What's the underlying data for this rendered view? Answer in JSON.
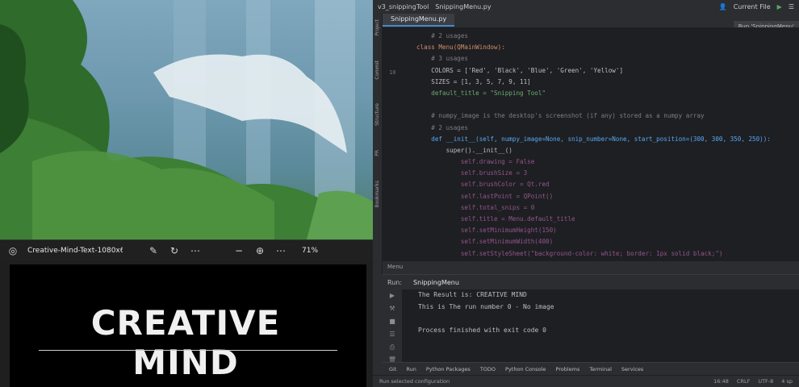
{
  "viewer": {
    "title": "Creative-Mind-Text-1080x6...",
    "zoom": "71%",
    "image_text": "CREATIVE MIND",
    "icons": [
      "photo-app-icon",
      "edit-icon",
      "rotate-icon",
      "more-icon",
      "zoom-out-icon",
      "zoom-in-icon",
      "more-icon"
    ]
  },
  "ide": {
    "project": "v3_snippingTool",
    "file_breadcrumb": "SnippingMenu.py",
    "current_file": "Current File",
    "tab": "SnippingMenu.py",
    "run_popup": "Run 'SnippingMenu'",
    "side_tools": [
      "Project",
      "Commit",
      "Structure",
      "PR",
      "Bookmarks"
    ],
    "line_number": "10",
    "code_lines": [
      "    # 2 usages",
      "class Menu(QMainWindow):",
      "    # 3 usages",
      "    COLORS = ['Red', 'Black', 'Blue', 'Green', 'Yellow']",
      "    SIZES = [1, 3, 5, 7, 9, 11]",
      "    default_title = \"Snipping Tool\"",
      "",
      "    # numpy_image is the desktop's screenshot (if any) stored as a numpy array",
      "    # 2 usages",
      "    def __init__(self, numpy_image=None, snip_number=None, start_position=(300, 300, 350, 250)):",
      "        super().__init__()",
      "            self.drawing = False",
      "            self.brushSize = 3",
      "            self.brushColor = Qt.red",
      "            self.lastPoint = QPoint()",
      "            self.total_snips = 0",
      "            self.title = Menu.default_title",
      "            self.setMinimumHeight(150)",
      "            self.setMinimumWidth(400)",
      "            self.setStyleSheet(\"background-color: white; border: 1px solid black;\")"
    ],
    "breadcrumb_bottom": "Menu",
    "run": {
      "label": "Run:",
      "tab": "SnippingMenu",
      "console": [
        "The Result is: CREATIVE MIND",
        "This is The run number 0 - No image",
        "",
        "Process finished with exit code 0"
      ]
    },
    "tool_tabs": [
      "Git",
      "Run",
      "Python Packages",
      "TODO",
      "Python Console",
      "Problems",
      "Terminal",
      "Services"
    ],
    "status": {
      "left": "Run selected configuration",
      "position": "16:48",
      "line_sep": "CRLF",
      "encoding": "UTF-8",
      "indent": "4 sp"
    }
  }
}
